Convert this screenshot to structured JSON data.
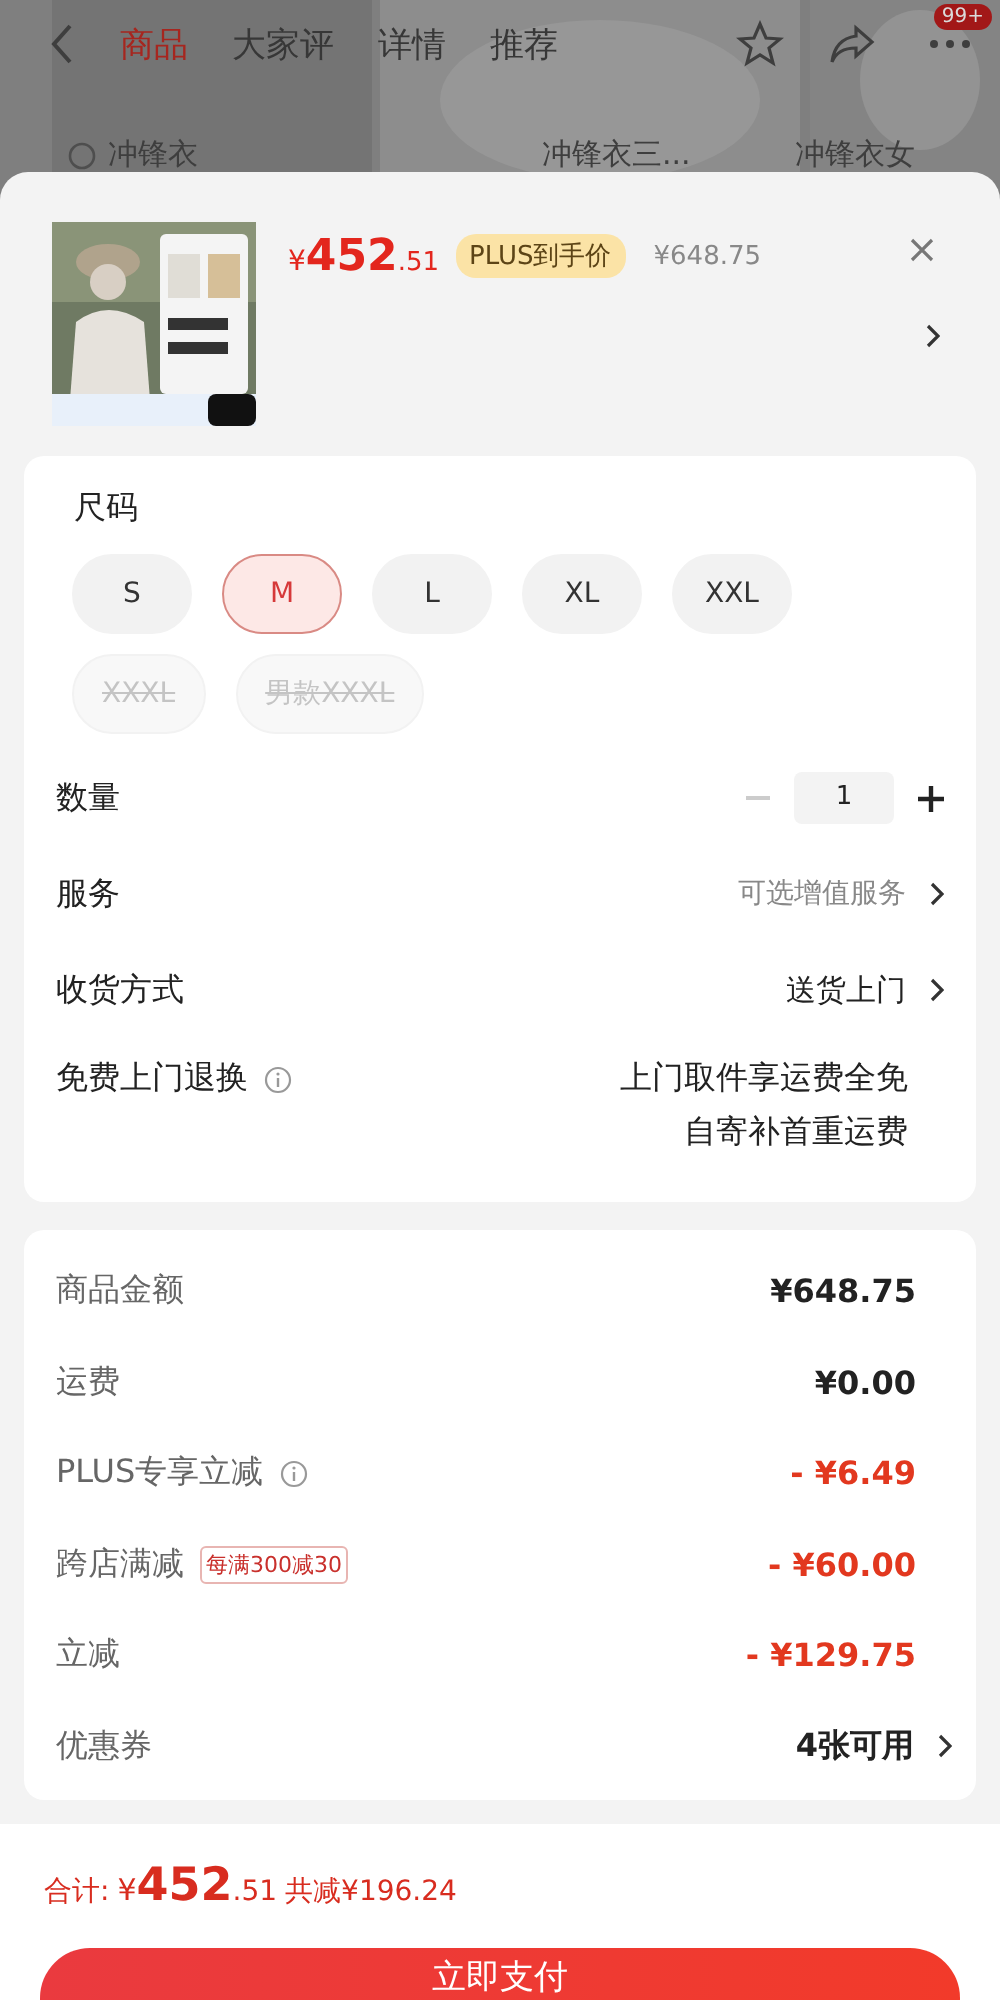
{
  "nav": {
    "tabs": [
      {
        "label": "商品",
        "selected": true
      },
      {
        "label": "大家评",
        "selected": false
      },
      {
        "label": "详情",
        "selected": false
      },
      {
        "label": "推荐",
        "selected": false
      }
    ],
    "badge": "99+"
  },
  "background_labels": [
    "冲锋衣",
    "冲锋衣三...",
    "冲锋衣女"
  ],
  "product": {
    "price_symbol": "¥",
    "price_int": "452",
    "price_dec": ".51",
    "plus_tag": "PLUS到手价",
    "original_price": "¥648.75"
  },
  "size": {
    "title": "尺码",
    "options": [
      {
        "label": "S",
        "selected": false,
        "disabled": false
      },
      {
        "label": "M",
        "selected": true,
        "disabled": false
      },
      {
        "label": "L",
        "selected": false,
        "disabled": false
      },
      {
        "label": "XL",
        "selected": false,
        "disabled": false
      },
      {
        "label": "XXL",
        "selected": false,
        "disabled": false
      },
      {
        "label": "XXXL",
        "selected": false,
        "disabled": true
      },
      {
        "label": "男款XXXL",
        "selected": false,
        "disabled": true
      }
    ]
  },
  "quantity": {
    "label": "数量",
    "value": "1"
  },
  "options": [
    {
      "label": "服务",
      "value": "可选增值服务",
      "muted": true
    },
    {
      "label": "收货方式",
      "value": "送货上门",
      "muted": false
    }
  ],
  "return": {
    "label": "免费上门退换",
    "lines": [
      "上门取件享运费全免",
      "自寄补首重运费"
    ]
  },
  "summary": [
    {
      "label": "商品金额",
      "value": "¥648.75",
      "discount": false,
      "info": false,
      "arrow": false
    },
    {
      "label": "运费",
      "value": "¥0.00",
      "discount": false,
      "info": false,
      "arrow": false
    },
    {
      "label": "PLUS专享立减",
      "value": "- ¥6.49",
      "discount": true,
      "info": true,
      "arrow": false
    },
    {
      "label": "跨店满减",
      "tag": "每满300减30",
      "value": "- ¥60.00",
      "discount": true,
      "info": false,
      "arrow": false
    },
    {
      "label": "立减",
      "value": "- ¥129.75",
      "discount": true,
      "info": false,
      "arrow": false
    },
    {
      "label": "优惠券",
      "value": "4张可用",
      "discount": false,
      "info": false,
      "arrow": true
    }
  ],
  "footer": {
    "total_label": "合计:",
    "symbol": "¥",
    "int": "452",
    "dec": ".51",
    "saved": "共减¥196.24",
    "pay": "立即支付"
  }
}
